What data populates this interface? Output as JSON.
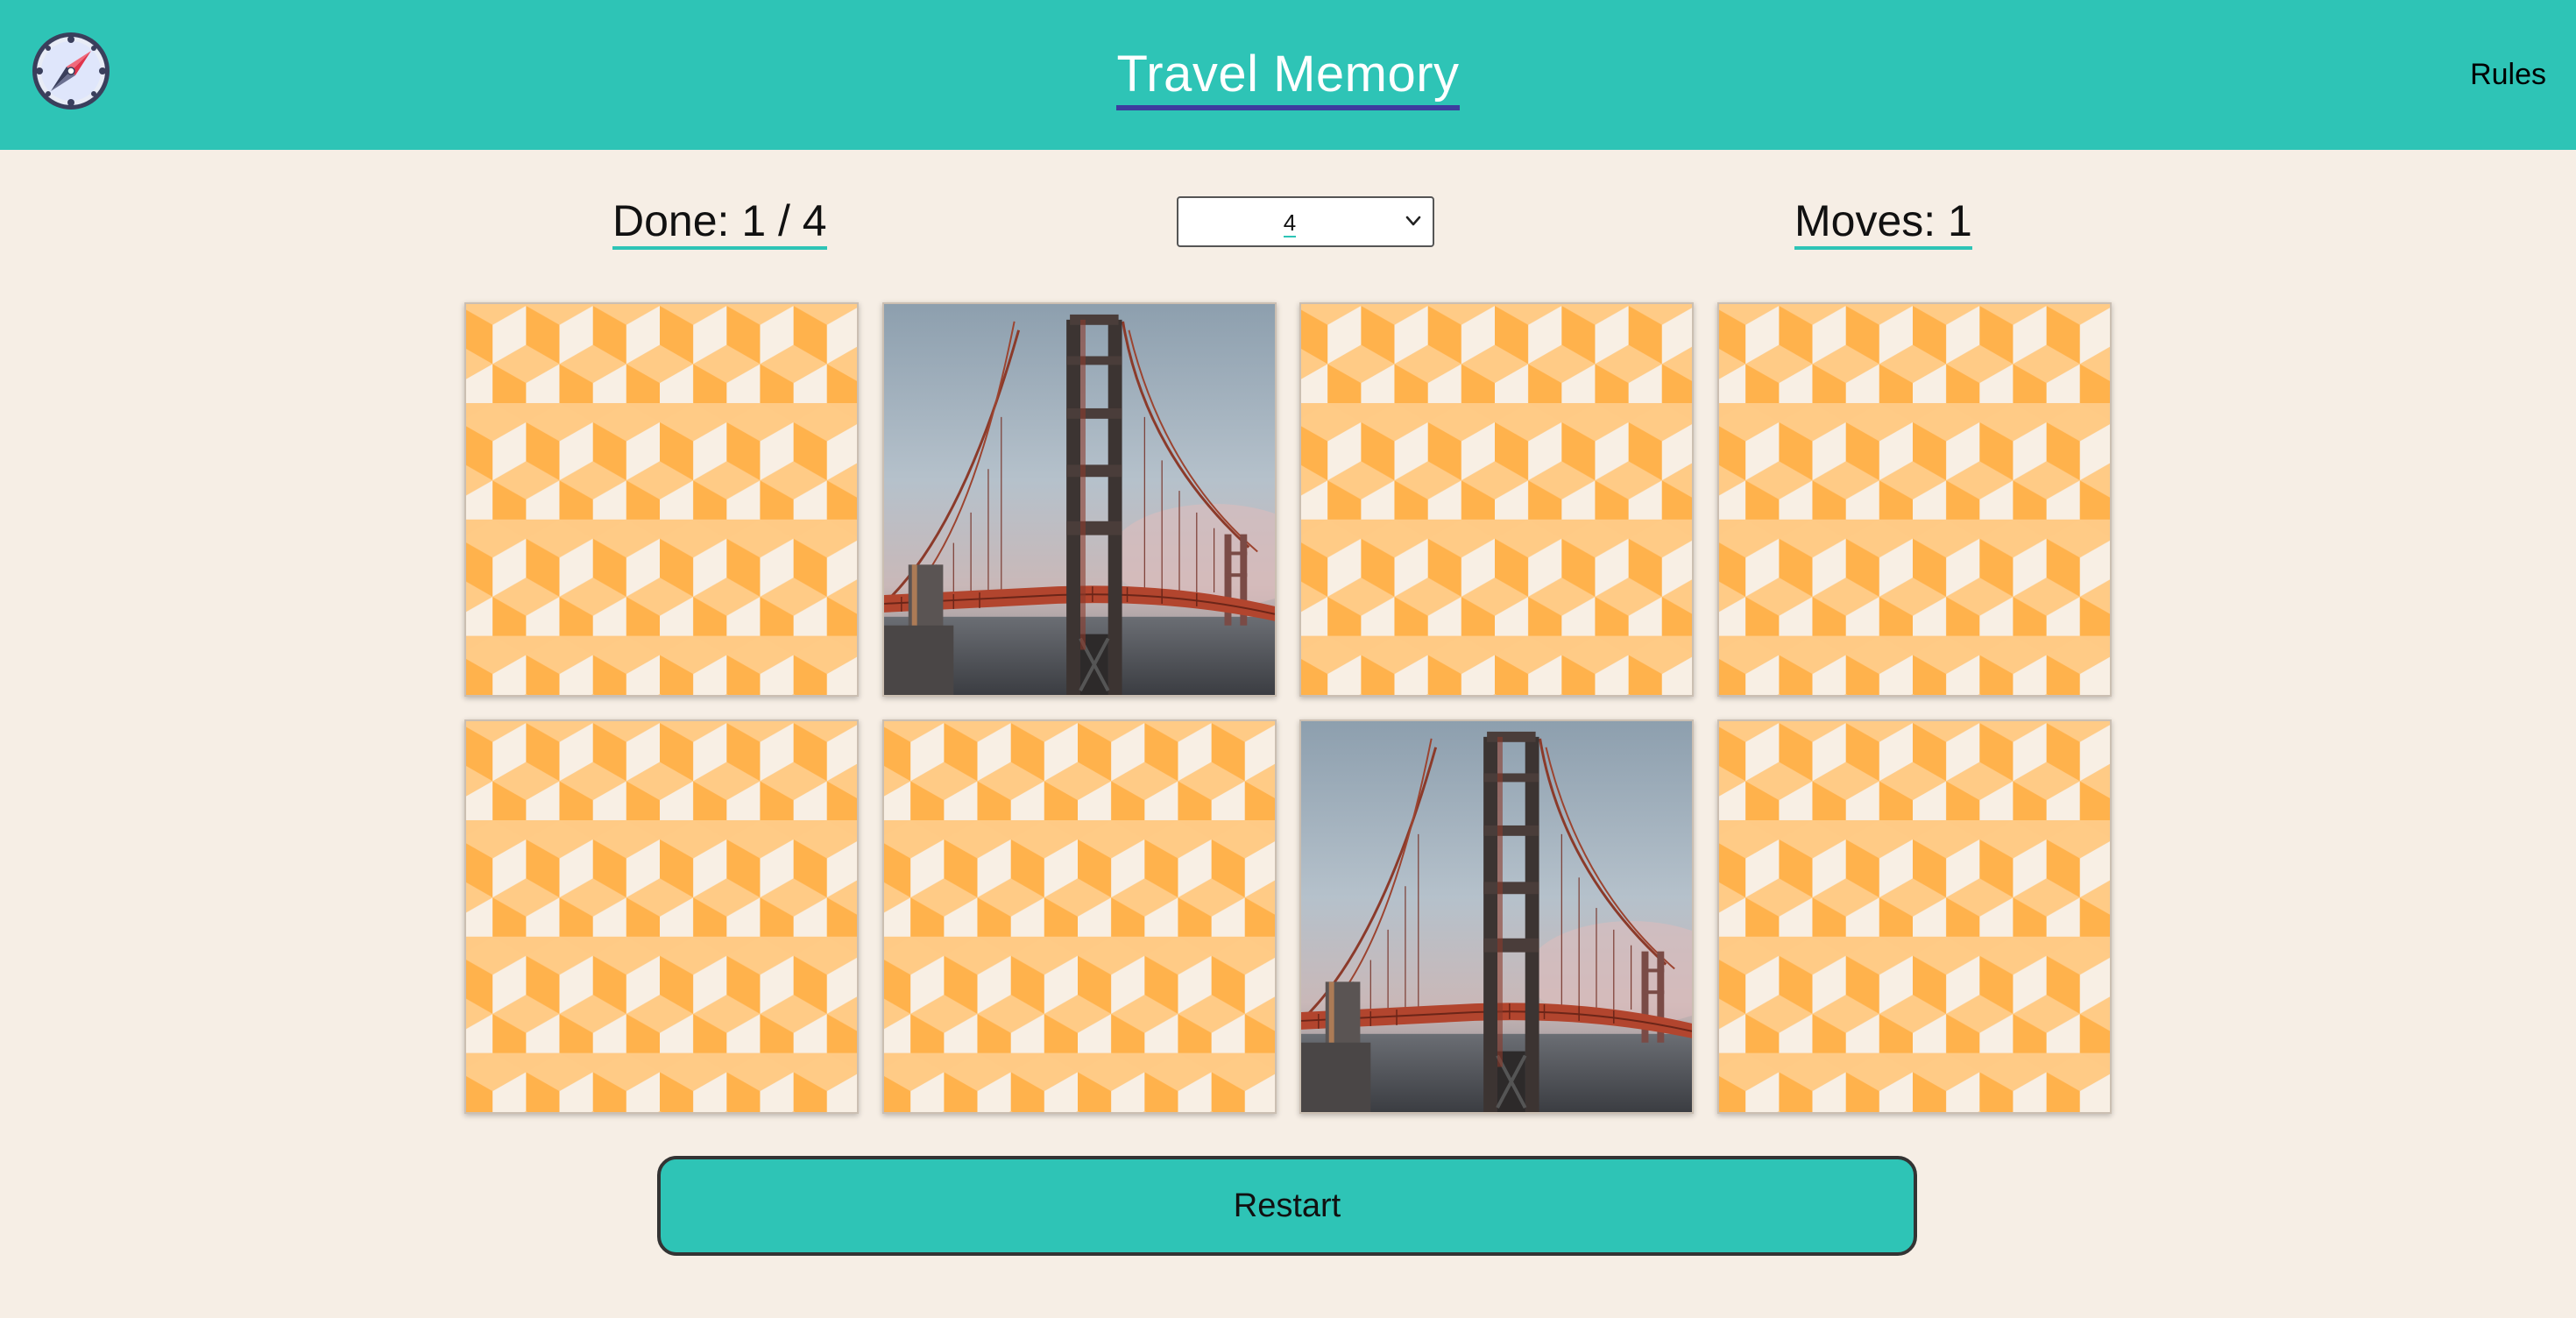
{
  "app": {
    "title": "Travel Memory",
    "nav": {
      "rules_label": "Rules"
    },
    "logo_icon": "compass-icon"
  },
  "stats": {
    "done_label": "Done: 1 / 4",
    "moves_label": "Moves: 1"
  },
  "board_size": {
    "selected": "4"
  },
  "cards": [
    {
      "state": "face-down"
    },
    {
      "state": "face-up",
      "image": "golden-gate-bridge"
    },
    {
      "state": "face-down"
    },
    {
      "state": "face-down"
    },
    {
      "state": "face-down"
    },
    {
      "state": "face-down"
    },
    {
      "state": "face-up",
      "image": "golden-gate-bridge"
    },
    {
      "state": "face-down"
    }
  ],
  "restart_label": "Restart",
  "colors": {
    "header": "#2ec4b6",
    "background": "#f6eee5",
    "card_pattern_dark": "#ffb04a",
    "card_pattern_light": "#ffcc88",
    "card_pattern_pale": "#f8efe4"
  }
}
